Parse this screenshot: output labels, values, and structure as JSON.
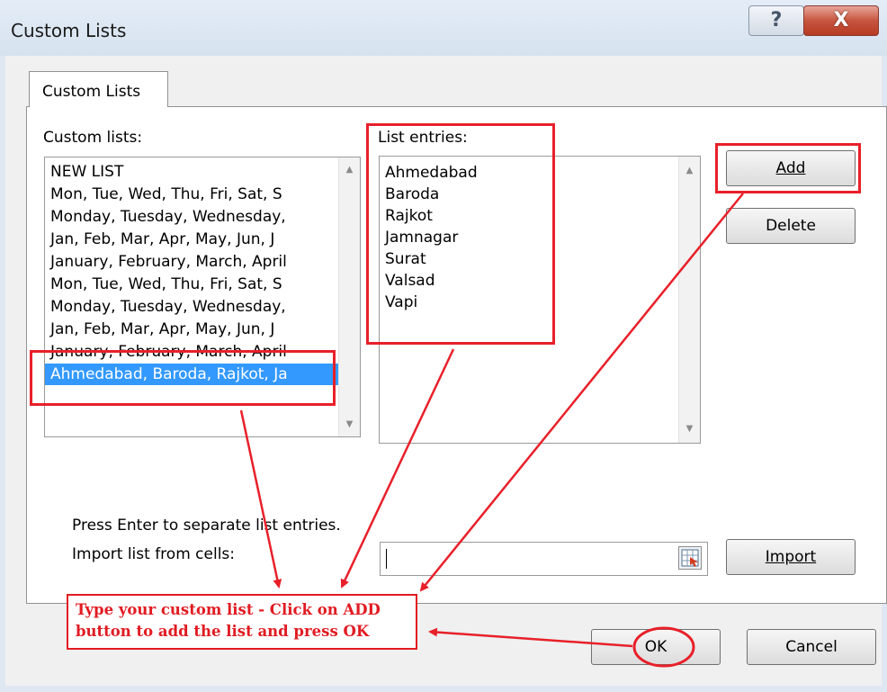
{
  "window": {
    "title": "Custom Lists",
    "help_glyph": "?",
    "close_glyph": "X"
  },
  "tab": {
    "label": "Custom Lists"
  },
  "custom_lists": {
    "label": "Custom lists:",
    "items": [
      "NEW LIST",
      "Mon, Tue, Wed, Thu, Fri, Sat, S",
      "Monday, Tuesday, Wednesday,",
      "Jan, Feb, Mar, Apr, May, Jun, J",
      "January, February, March, April",
      "Mon, Tue, Wed, Thu, Fri, Sat, S",
      "Monday, Tuesday, Wednesday,",
      "Jan, Feb, Mar, Apr, May, Jun, J",
      "January, February, March, April",
      "Ahmedabad, Baroda, Rajkot, Ja"
    ],
    "selected_index": 9
  },
  "list_entries": {
    "label": "List entries:",
    "items": [
      "Ahmedabad",
      "Baroda",
      "Rajkot",
      "Jamnagar",
      "Surat",
      "Valsad",
      "Vapi"
    ]
  },
  "buttons": {
    "add": "Add",
    "delete": "Delete",
    "import": "Import",
    "ok": "OK",
    "cancel": "Cancel"
  },
  "hint": "Press Enter to separate list entries.",
  "import_label": "Import list from cells:",
  "import_value": "",
  "annotation": {
    "line1": "Type your custom list - Click on ADD",
    "line2": "button to add the list and press OK",
    "color": "#e11b22"
  },
  "colors": {
    "selection": "#3399ff",
    "annotation_red": "#e8202a"
  },
  "icons": {
    "range_picker": "collapse-dialog-icon"
  }
}
